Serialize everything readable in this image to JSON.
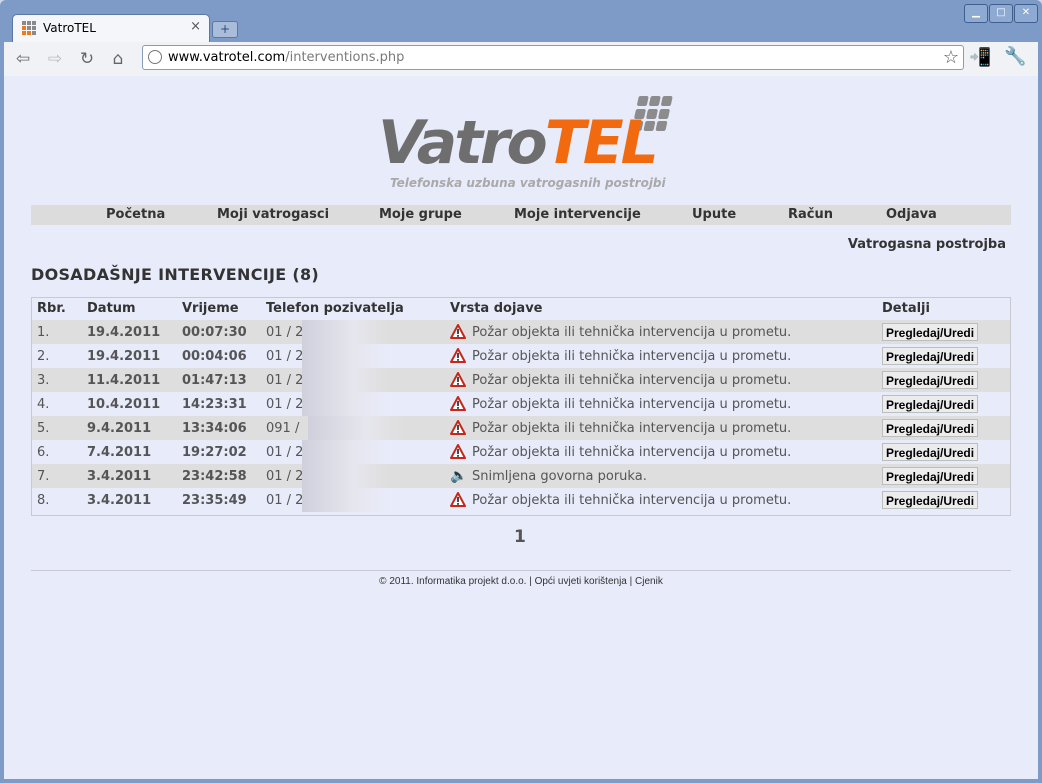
{
  "browser": {
    "tab_title": "VatroTEL",
    "tab_close": "×",
    "new_tab": "+",
    "url_domain": "www.vatrotel.com",
    "url_path": "/interventions.php"
  },
  "logo": {
    "word_a": "Vatro",
    "word_b": "TEL",
    "tagline": "Telefonska uzbuna vatrogasnih postrojbi"
  },
  "menu": [
    "Početna",
    "Moji vatrogasci",
    "Moje grupe",
    "Moje intervencije",
    "Upute",
    "Račun",
    "Odjava"
  ],
  "org_name": "Vatrogasna postrojba",
  "heading": "DOSADAŠNJE INTERVENCIJE (8)",
  "table": {
    "headers": [
      "Rbr.",
      "Datum",
      "Vrijeme",
      "Telefon pozivatelja",
      "Vrsta dojave",
      "Detalji"
    ],
    "rows": [
      {
        "num": "1.",
        "date": "19.4.2011",
        "time": "00:07:30",
        "phone": "01 / 2",
        "type": "Požar objekta ili tehnička intervencija u prometu.",
        "icon": "warning-icon",
        "action": "Pregledaj/Uredi"
      },
      {
        "num": "2.",
        "date": "19.4.2011",
        "time": "00:04:06",
        "phone": "01 / 2",
        "type": "Požar objekta ili tehnička intervencija u prometu.",
        "icon": "warning-icon",
        "action": "Pregledaj/Uredi"
      },
      {
        "num": "3.",
        "date": "11.4.2011",
        "time": "01:47:13",
        "phone": "01 / 2",
        "type": "Požar objekta ili tehnička intervencija u prometu.",
        "icon": "warning-icon",
        "action": "Pregledaj/Uredi"
      },
      {
        "num": "4.",
        "date": "10.4.2011",
        "time": "14:23:31",
        "phone": "01 / 2",
        "type": "Požar objekta ili tehnička intervencija u prometu.",
        "icon": "warning-icon",
        "action": "Pregledaj/Uredi"
      },
      {
        "num": "5.",
        "date": "9.4.2011",
        "time": "13:34:06",
        "phone": "091 /",
        "type": "Požar objekta ili tehnička intervencija u prometu.",
        "icon": "warning-icon",
        "action": "Pregledaj/Uredi"
      },
      {
        "num": "6.",
        "date": "7.4.2011",
        "time": "19:27:02",
        "phone": "01 / 2",
        "type": "Požar objekta ili tehnička intervencija u prometu.",
        "icon": "warning-icon",
        "action": "Pregledaj/Uredi"
      },
      {
        "num": "7.",
        "date": "3.4.2011",
        "time": "23:42:58",
        "phone": "01 / 2",
        "type": "Snimljena govorna poruka.",
        "icon": "speaker-icon",
        "action": "Pregledaj/Uredi"
      },
      {
        "num": "8.",
        "date": "3.4.2011",
        "time": "23:35:49",
        "phone": "01 / 2",
        "type": "Požar objekta ili tehnička intervencija u prometu.",
        "icon": "warning-icon",
        "action": "Pregledaj/Uredi"
      }
    ]
  },
  "pager": "1",
  "footer": {
    "copyright": "© 2011. Informatika projekt d.o.o. |",
    "terms": "Opći uvjeti korištenja",
    "sep": "|",
    "pricing": "Cjenik"
  },
  "colors": {
    "brand_orange": "#f26a10",
    "brand_gray": "#6e6e6e",
    "page_bg": "#e8ebfa",
    "menu_bg": "#dcdcdc",
    "warning_red": "#c8261a"
  }
}
